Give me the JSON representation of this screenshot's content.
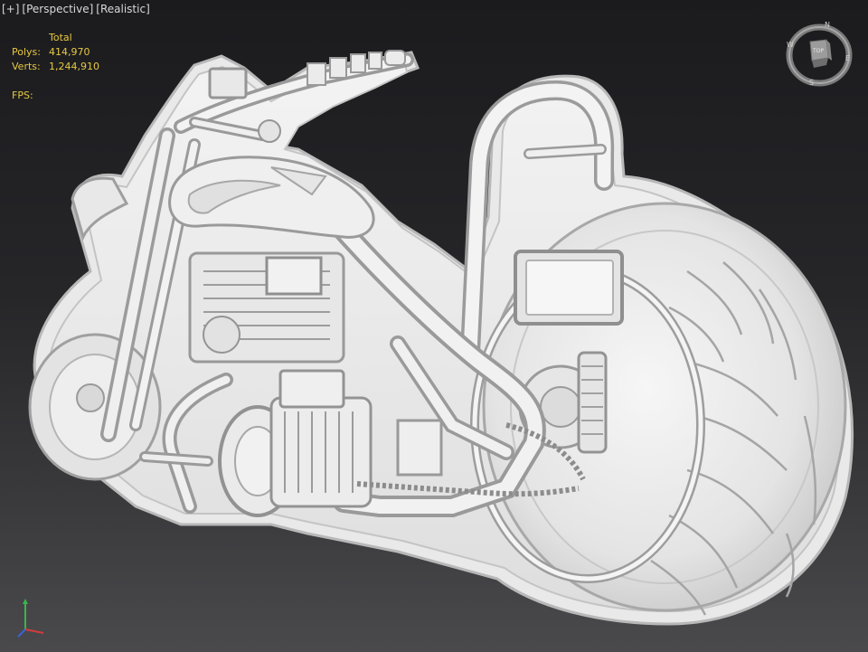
{
  "viewport": {
    "labels": [
      "[+]",
      "[Perspective]",
      "[Realistic]"
    ],
    "stats": {
      "header": "Total",
      "polys_label": "Polys:",
      "polys_value": "414,970",
      "verts_label": "Verts:",
      "verts_value": "1,244,910",
      "fps_label": "FPS:"
    },
    "viewcube": {
      "face_label": "TOP",
      "compass": {
        "n": "N",
        "e": "E",
        "s": "S",
        "w": "W"
      }
    }
  },
  "colors": {
    "stats_text": "#e6c940",
    "label_text": "#d8d8d8",
    "model_fill": "#ececec",
    "model_shadow": "#a9a9a9"
  }
}
